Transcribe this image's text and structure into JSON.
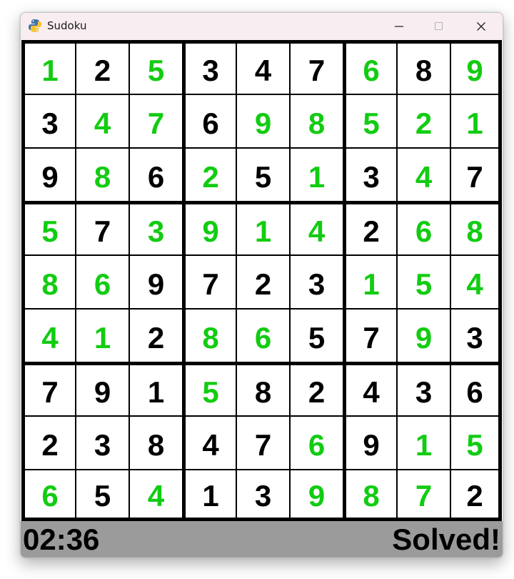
{
  "window": {
    "title": "Sudoku",
    "icon": "python-snake-icon",
    "buttons": [
      "minimize-icon",
      "maximize-icon",
      "close-icon"
    ]
  },
  "colors": {
    "given": "#000000",
    "entered": "#12cc12",
    "grid": "#000000",
    "status_bar": "#9b9b9b",
    "title_bar": "#f8eef1"
  },
  "board": {
    "values": [
      [
        1,
        2,
        5,
        3,
        4,
        7,
        6,
        8,
        9
      ],
      [
        3,
        4,
        7,
        6,
        9,
        8,
        5,
        2,
        1
      ],
      [
        9,
        8,
        6,
        2,
        5,
        1,
        3,
        4,
        7
      ],
      [
        5,
        7,
        3,
        9,
        1,
        4,
        2,
        6,
        8
      ],
      [
        8,
        6,
        9,
        7,
        2,
        3,
        1,
        5,
        4
      ],
      [
        4,
        1,
        2,
        8,
        6,
        5,
        7,
        9,
        3
      ],
      [
        7,
        9,
        1,
        5,
        8,
        2,
        4,
        3,
        6
      ],
      [
        2,
        3,
        8,
        4,
        7,
        6,
        9,
        1,
        5
      ],
      [
        6,
        5,
        4,
        1,
        3,
        9,
        8,
        7,
        2
      ]
    ],
    "entered": [
      [
        1,
        0,
        1,
        0,
        0,
        0,
        1,
        0,
        1
      ],
      [
        0,
        1,
        1,
        0,
        1,
        1,
        1,
        1,
        1
      ],
      [
        0,
        1,
        0,
        1,
        0,
        1,
        0,
        1,
        0
      ],
      [
        1,
        0,
        1,
        1,
        1,
        1,
        0,
        1,
        1
      ],
      [
        1,
        1,
        0,
        0,
        0,
        0,
        1,
        1,
        1
      ],
      [
        1,
        1,
        0,
        1,
        1,
        0,
        0,
        1,
        0
      ],
      [
        0,
        0,
        0,
        1,
        0,
        0,
        0,
        0,
        0
      ],
      [
        0,
        0,
        0,
        0,
        0,
        1,
        0,
        1,
        1
      ],
      [
        1,
        0,
        1,
        0,
        0,
        1,
        1,
        1,
        0
      ]
    ]
  },
  "status_bar": {
    "timer": "02:36",
    "status": "Solved!"
  }
}
